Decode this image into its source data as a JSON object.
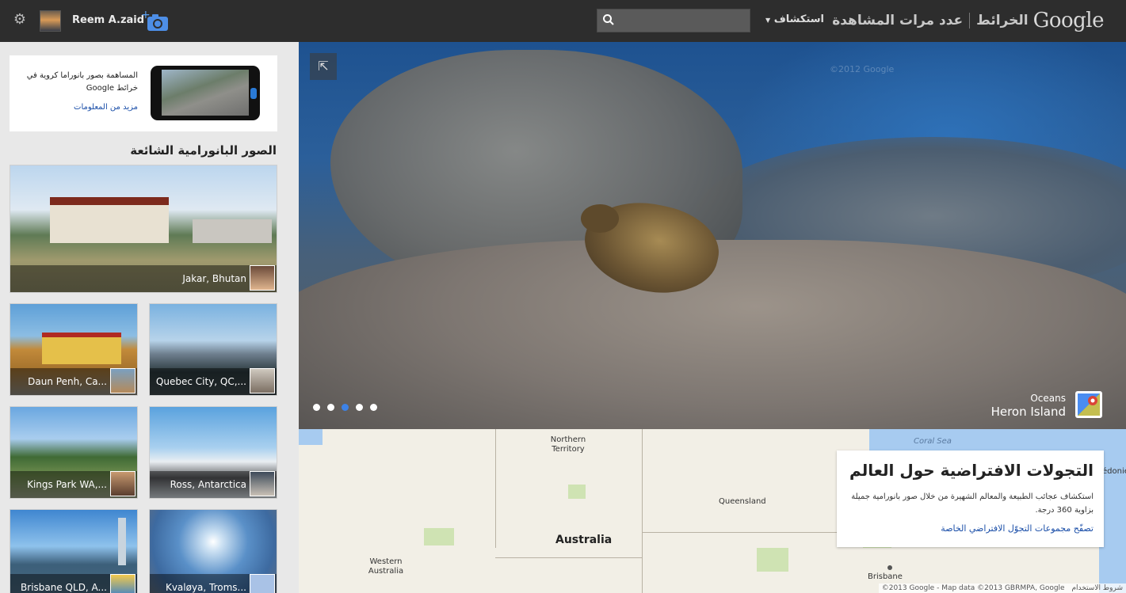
{
  "header": {
    "user_name": "Reem A.zaid",
    "search_placeholder": "",
    "explore_label": "استكشاف",
    "views_label": "عدد مرات المشاهدة",
    "maps_label": "الخرائط",
    "logo_text": "Google"
  },
  "sidebar": {
    "promo_text": "المساهمة بصور بانوراما كروية في خرائط Google",
    "promo_link": "مزيد من المعلومات",
    "popular_title": "الصور البانورامية الشائعة",
    "panoramas": [
      {
        "label": "Jakar, Bhutan"
      },
      {
        "label": "Daun Penh, Ca..."
      },
      {
        "label": "Quebec City, QC,..."
      },
      {
        "label": "Kings Park WA,..."
      },
      {
        "label": "Ross, Antarctica"
      },
      {
        "label": "Brisbane QLD, A..."
      },
      {
        "label": "Kvaløya, Troms..."
      }
    ]
  },
  "hero": {
    "watermark": "©2012 Google",
    "category": "Oceans",
    "place": "Heron Island",
    "slides_total": 5,
    "active_slide": 3
  },
  "map": {
    "labels": {
      "northern_territory": "Northern Territory",
      "queensland": "Queensland",
      "australia": "Australia",
      "western_australia": "Western Australia",
      "brisbane": "Brisbane",
      "coral_sea": "Coral Sea",
      "caledonia": "édonie"
    },
    "attribution": "©2013 Google - Map data ©2013 GBRMPA, Google",
    "terms": "شروط الاستخدام"
  },
  "tour_card": {
    "title": "التجولات الافتراضية حول العالم",
    "description": "استكشاف عجائب الطبيعة والمعالم الشهيرة من خلال صور بانورامية جميلة بزاوية 360 درجة.",
    "link": "تصفّح مجموعات التجوّل الافتراضي الخاصة"
  }
}
